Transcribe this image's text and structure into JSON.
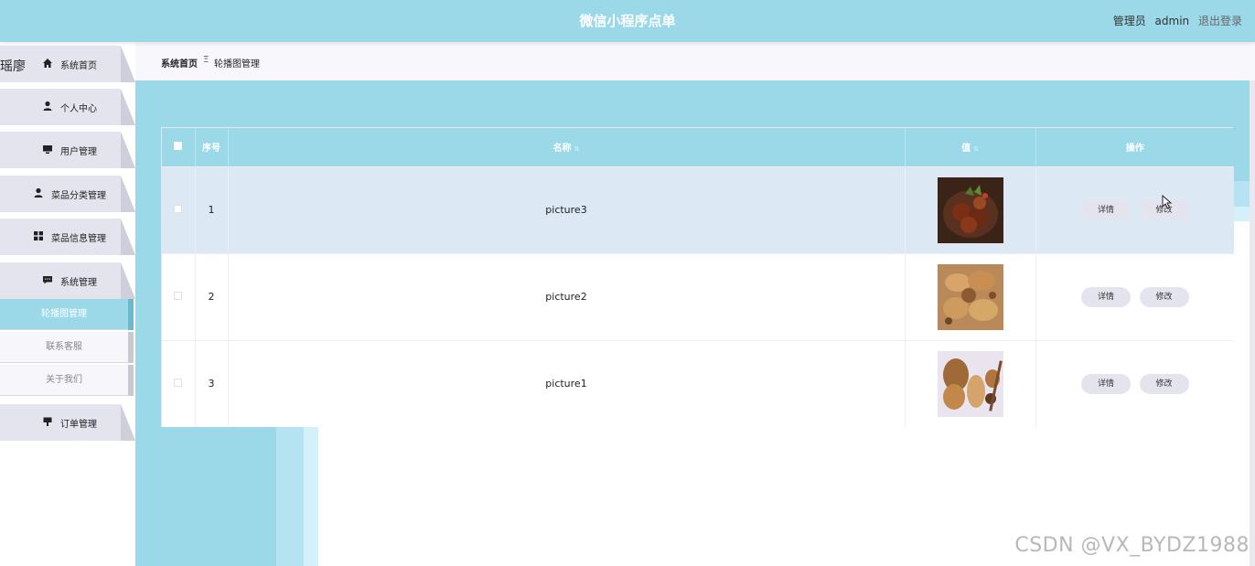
{
  "header": {
    "title": "微信小程序点单",
    "user_label": "管理员",
    "username": "admin",
    "logout": "退出登录"
  },
  "sidebar": {
    "logo_fragment": "瑶廖",
    "items": [
      {
        "label": "系统首页",
        "icon": "home-icon"
      },
      {
        "label": "个人中心",
        "icon": "user-icon"
      },
      {
        "label": "用户管理",
        "icon": "monitor-icon"
      },
      {
        "label": "菜品分类管理",
        "icon": "user-icon"
      },
      {
        "label": "菜品信息管理",
        "icon": "grid-icon"
      },
      {
        "label": "系统管理",
        "icon": "chat-icon"
      }
    ],
    "subitems": [
      {
        "label": "轮播图管理",
        "active": true
      },
      {
        "label": "联系客服",
        "active": false
      },
      {
        "label": "关于我们",
        "active": false
      }
    ],
    "last_item": {
      "label": "订单管理",
      "icon": "pin-icon"
    }
  },
  "breadcrumb": {
    "home": "系统首页",
    "separator": "Ξ",
    "current": "轮播图管理"
  },
  "table": {
    "columns": [
      "序号",
      "名称",
      "值",
      "操作"
    ],
    "rows": [
      {
        "index": "1",
        "name": "picture3",
        "detail": "详情",
        "edit": "修改"
      },
      {
        "index": "2",
        "name": "picture2",
        "detail": "详情",
        "edit": "修改"
      },
      {
        "index": "3",
        "name": "picture1",
        "detail": "详情",
        "edit": "修改"
      }
    ]
  },
  "watermark": "CSDN @VX_BYDZ1988",
  "colors": {
    "accent": "#9bd9e8",
    "sidebar_item": "#e4e4ee",
    "row_hover": "#dce8f3"
  }
}
